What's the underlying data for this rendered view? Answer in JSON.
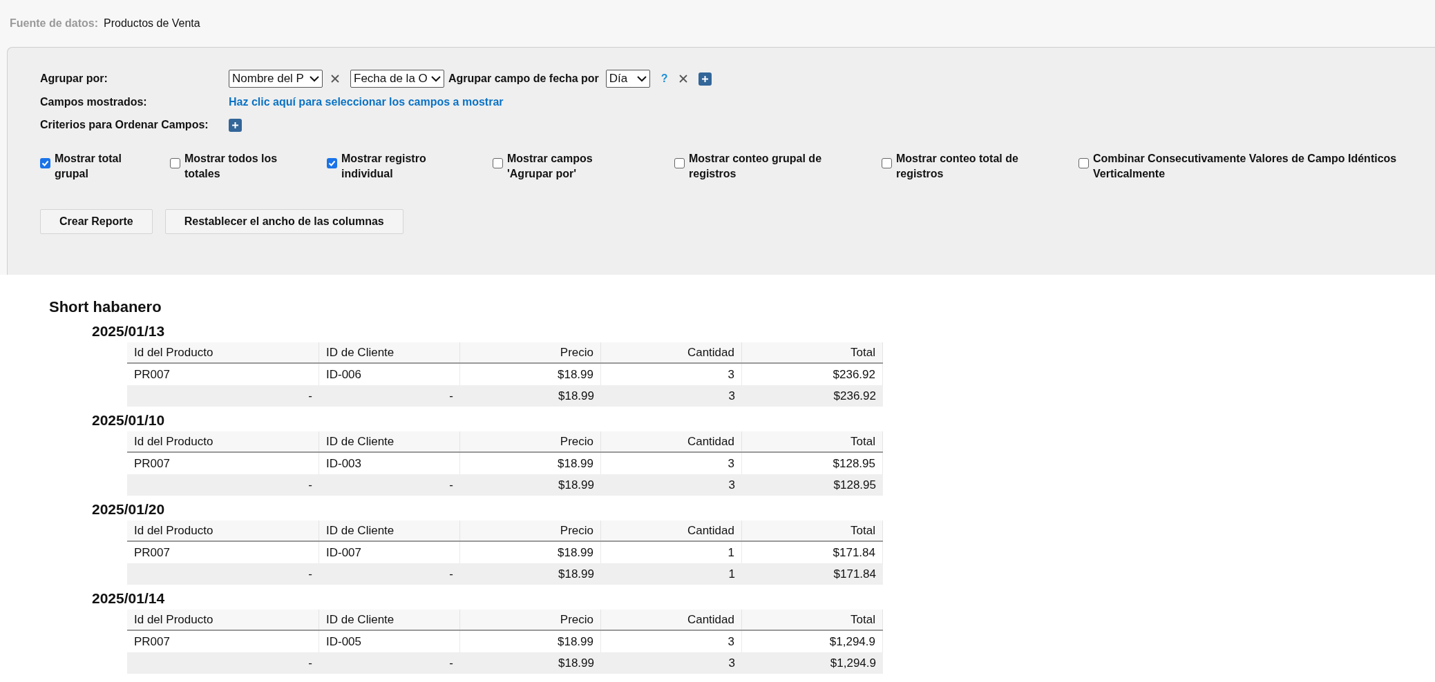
{
  "data_source": {
    "label": "Fuente de datos:",
    "value": "Productos de Venta"
  },
  "options": {
    "group_by": {
      "label": "Agrupar por:",
      "field_select": "Nombre del P",
      "date_field_select": "Fecha de la O",
      "date_group_label": "Agrupar campo de fecha por",
      "date_unit_select": "Día",
      "help": "?"
    },
    "fields_shown": {
      "label": "Campos mostrados:",
      "link": "Haz clic aquí para seleccionar los campos a mostrar"
    },
    "sort": {
      "label": "Criterios para Ordenar Campos:"
    },
    "checkboxes": [
      {
        "label": "Mostrar total grupal",
        "checked": true
      },
      {
        "label": "Mostrar todos los totales",
        "checked": false
      },
      {
        "label": "Mostrar registro individual",
        "checked": true
      },
      {
        "label": "Mostrar campos 'Agrupar por'",
        "checked": false
      },
      {
        "label": "Mostrar conteo grupal de registros",
        "checked": false
      },
      {
        "label": "Mostrar conteo total de registros",
        "checked": false
      },
      {
        "label": "Combinar Consecutivamente Valores de Campo Idénticos Verticalmente",
        "checked": false
      }
    ],
    "buttons": [
      "Crear Reporte",
      "Restablecer el ancho de las columnas"
    ]
  },
  "report": {
    "title": "Short habanero",
    "groups": [
      {
        "date": "2025/01/13",
        "columns": [
          "Id del Producto",
          "ID de Cliente",
          "Precio",
          "Cantidad",
          "Total"
        ],
        "rows": [
          [
            "PR007",
            "ID-006",
            "$18.99",
            "3",
            "$236.92"
          ]
        ],
        "totals": [
          "-",
          "-",
          "$18.99",
          "3",
          "$236.92"
        ]
      },
      {
        "date": "2025/01/10",
        "columns": [
          "Id del Producto",
          "ID de Cliente",
          "Precio",
          "Cantidad",
          "Total"
        ],
        "rows": [
          [
            "PR007",
            "ID-003",
            "$18.99",
            "3",
            "$128.95"
          ]
        ],
        "totals": [
          "-",
          "-",
          "$18.99",
          "3",
          "$128.95"
        ]
      },
      {
        "date": "2025/01/20",
        "columns": [
          "Id del Producto",
          "ID de Cliente",
          "Precio",
          "Cantidad",
          "Total"
        ],
        "rows": [
          [
            "PR007",
            "ID-007",
            "$18.99",
            "1",
            "$171.84"
          ]
        ],
        "totals": [
          "-",
          "-",
          "$18.99",
          "1",
          "$171.84"
        ]
      },
      {
        "date": "2025/01/14",
        "columns": [
          "Id del Producto",
          "ID de Cliente",
          "Precio",
          "Cantidad",
          "Total"
        ],
        "rows": [
          [
            "PR007",
            "ID-005",
            "$18.99",
            "3",
            "$1,294.9"
          ]
        ],
        "totals": [
          "-",
          "-",
          "$18.99",
          "3",
          "$1,294.9"
        ]
      }
    ]
  }
}
